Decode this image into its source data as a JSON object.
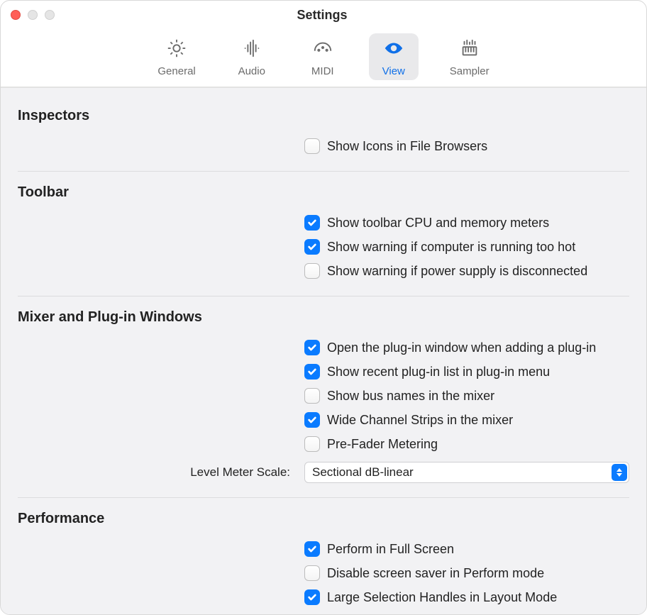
{
  "window": {
    "title": "Settings"
  },
  "tabs": {
    "general": "General",
    "audio": "Audio",
    "midi": "MIDI",
    "view": "View",
    "sampler": "Sampler",
    "active": "view"
  },
  "sections": {
    "inspectors": {
      "title": "Inspectors",
      "opts": {
        "show_icons": {
          "label": "Show Icons in File Browsers",
          "checked": false
        }
      }
    },
    "toolbar": {
      "title": "Toolbar",
      "opts": {
        "cpu_meters": {
          "label": "Show toolbar CPU and memory meters",
          "checked": true
        },
        "warn_hot": {
          "label": "Show warning if computer is running too hot",
          "checked": true
        },
        "warn_power": {
          "label": "Show warning if power supply is disconnected",
          "checked": false
        }
      }
    },
    "mixer": {
      "title": "Mixer and Plug-in Windows",
      "opts": {
        "open_plugin": {
          "label": "Open the plug-in window when adding a plug-in",
          "checked": true
        },
        "recent_list": {
          "label": "Show recent plug-in list in plug-in menu",
          "checked": true
        },
        "bus_names": {
          "label": "Show bus names in the mixer",
          "checked": false
        },
        "wide_strips": {
          "label": "Wide Channel Strips in the mixer",
          "checked": true
        },
        "prefader": {
          "label": "Pre-Fader Metering",
          "checked": false
        }
      },
      "level_meter": {
        "label": "Level Meter Scale:",
        "value": "Sectional dB-linear"
      }
    },
    "performance": {
      "title": "Performance",
      "opts": {
        "fullscreen": {
          "label": "Perform in Full Screen",
          "checked": true
        },
        "disable_ss": {
          "label": "Disable screen saver in Perform mode",
          "checked": false
        },
        "large_handles": {
          "label": "Large Selection Handles in Layout Mode",
          "checked": true
        }
      }
    }
  }
}
